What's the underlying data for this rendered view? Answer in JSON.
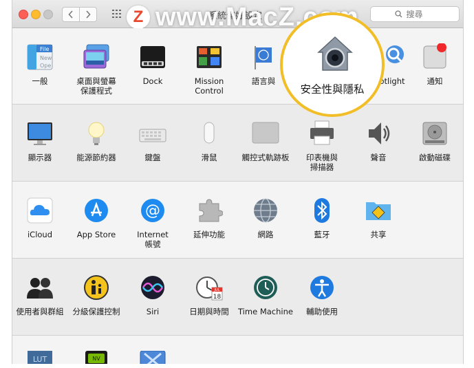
{
  "window": {
    "title": "系統偏好設定"
  },
  "search": {
    "placeholder": "搜尋"
  },
  "watermark": {
    "logo": "Z",
    "text": "www.MacZ.com"
  },
  "spotlight": {
    "label": "安全性與隱私",
    "ring_color": "#f2be28"
  },
  "rows": [
    [
      {
        "name": "general",
        "label": "一般"
      },
      {
        "name": "desktop-screensaver",
        "label": "桌面與螢幕\n保護程式"
      },
      {
        "name": "dock",
        "label": "Dock"
      },
      {
        "name": "mission-control",
        "label": "Mission\nControl"
      },
      {
        "name": "language-region",
        "label": "語言與"
      },
      {
        "name": "security-privacy",
        "label": "安全性與隱私"
      },
      {
        "name": "spotlight",
        "label": "otlight"
      },
      {
        "name": "notifications",
        "label": "通知"
      }
    ],
    [
      {
        "name": "displays",
        "label": "顯示器"
      },
      {
        "name": "energy-saver",
        "label": "能源節約器"
      },
      {
        "name": "keyboard",
        "label": "鍵盤"
      },
      {
        "name": "mouse",
        "label": "滑鼠"
      },
      {
        "name": "trackpad",
        "label": "觸控式軌跡板"
      },
      {
        "name": "printers-scanners",
        "label": "印表機與\n掃描器"
      },
      {
        "name": "sound",
        "label": "聲音"
      },
      {
        "name": "startup-disk",
        "label": "啟動磁碟"
      }
    ],
    [
      {
        "name": "icloud",
        "label": "iCloud"
      },
      {
        "name": "app-store",
        "label": "App Store"
      },
      {
        "name": "internet-accounts",
        "label": "Internet\n帳號"
      },
      {
        "name": "extensions",
        "label": "延伸功能"
      },
      {
        "name": "network",
        "label": "網路"
      },
      {
        "name": "bluetooth",
        "label": "藍牙"
      },
      {
        "name": "sharing",
        "label": "共享"
      }
    ],
    [
      {
        "name": "users-groups",
        "label": "使用者與群組"
      },
      {
        "name": "parental-controls",
        "label": "分級保護控制"
      },
      {
        "name": "siri",
        "label": "Siri"
      },
      {
        "name": "date-time",
        "label": "日期與時間"
      },
      {
        "name": "time-machine",
        "label": "Time Machine"
      },
      {
        "name": "accessibility",
        "label": "輔助使用"
      }
    ]
  ],
  "icon_texts": {
    "general_file": "File",
    "general_new": "New",
    "general_ope": "Ope",
    "calendar_month": "JUL",
    "calendar_day": "18",
    "nvidia_label": "NV",
    "lut": "LUT"
  }
}
